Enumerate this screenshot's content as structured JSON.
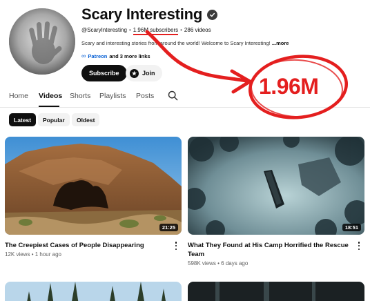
{
  "channel": {
    "name": "Scary Interesting",
    "handle": "@ScaryInteresting",
    "subscribers": "1.96M subscribers",
    "videos": "286 videos",
    "description": "Scary and interesting stories from around the world! Welcome to Scary Interesting!",
    "description_more": "...more",
    "link_label": "Patreon",
    "more_links": "and 3 more links",
    "subscribe_label": "Subscribe",
    "join_label": "Join"
  },
  "tabs": [
    "Home",
    "Videos",
    "Shorts",
    "Playlists",
    "Posts"
  ],
  "active_tab": "Videos",
  "chips": [
    "Latest",
    "Popular",
    "Oldest"
  ],
  "active_chip": "Latest",
  "videos": [
    {
      "title": "The Creepiest Cases of People Disappearing",
      "views": "12K views",
      "age": "1 hour ago",
      "duration": "21:25"
    },
    {
      "title": "What They Found at His Camp Horrified the Rescue Team",
      "views": "598K views",
      "age": "6 days ago",
      "duration": "18:51"
    }
  ],
  "annotation": {
    "callout": "1.96M",
    "color": "#e41f1f"
  },
  "colors": {
    "text_primary": "#0f0f0f",
    "text_secondary": "#606060",
    "link_blue": "#065fd4",
    "chip_bg": "#f2f2f2",
    "annotation_red": "#e41f1f"
  }
}
